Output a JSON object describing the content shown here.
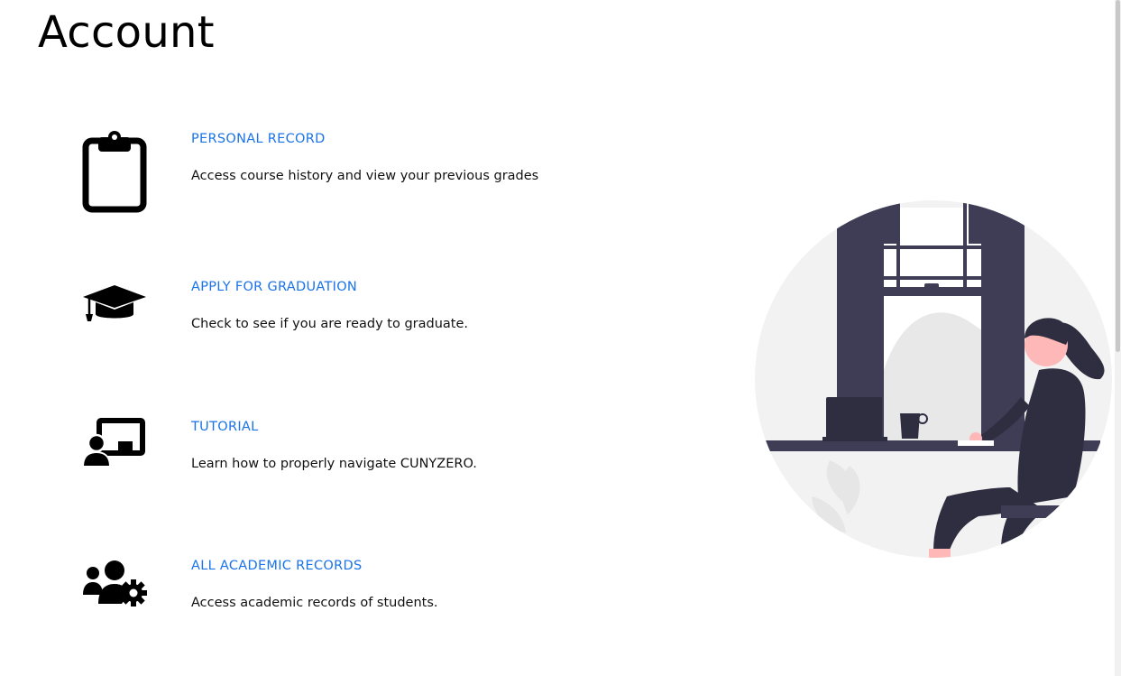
{
  "page": {
    "title": "Account"
  },
  "items": [
    {
      "icon": "clipboard-icon",
      "label": "PERSONAL RECORD",
      "description": "Access course history and view your previous grades"
    },
    {
      "icon": "graduation-cap-icon",
      "label": "APPLY FOR GRADUATION",
      "description": "Check to see if you are ready to graduate."
    },
    {
      "icon": "chalkboard-teacher-icon",
      "label": "TUTORIAL",
      "description": "Learn how to properly navigate CUNYZERO."
    },
    {
      "icon": "users-cog-icon",
      "label": "ALL ACADEMIC RECORDS",
      "description": "Access academic records of students."
    }
  ],
  "colors": {
    "link": "#1a73e8",
    "illustration_dark": "#3f3d56",
    "illustration_light": "#f2f2f2",
    "skin": "#ffb8b8"
  }
}
